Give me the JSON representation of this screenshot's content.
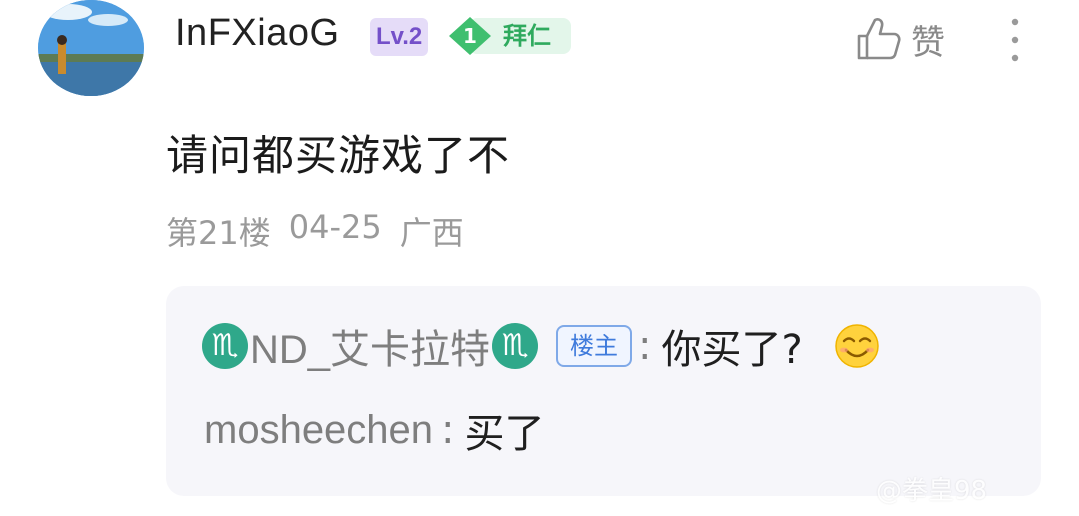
{
  "comment": {
    "username": "InFXiaoG",
    "level": "Lv.2",
    "fan_level": "1",
    "fan_badge": "拜仁",
    "like_label": "赞",
    "text": "请问都买游戏了不",
    "floor": "第21楼",
    "date": "04-25",
    "location": "广西",
    "colors": {
      "level_bg": "#e5dcf8",
      "level_text": "#7450c9",
      "fan_green": "#2faa5e",
      "meta_gray": "#9a9a9a",
      "reply_bg": "#f6f6fa",
      "op_badge_blue": "#3f7bdc"
    }
  },
  "replies": [
    {
      "user": "ND_艾卡拉特",
      "user_icon_left": "scorpio-icon",
      "user_icon_right": "scorpio-icon",
      "badge": "楼主",
      "separator": ":",
      "text": "你买了?",
      "emoji": "smile-emoji-icon"
    },
    {
      "user": "mosheechen",
      "separator": ":",
      "text": "买了"
    }
  ],
  "watermark": "@拳皇98"
}
